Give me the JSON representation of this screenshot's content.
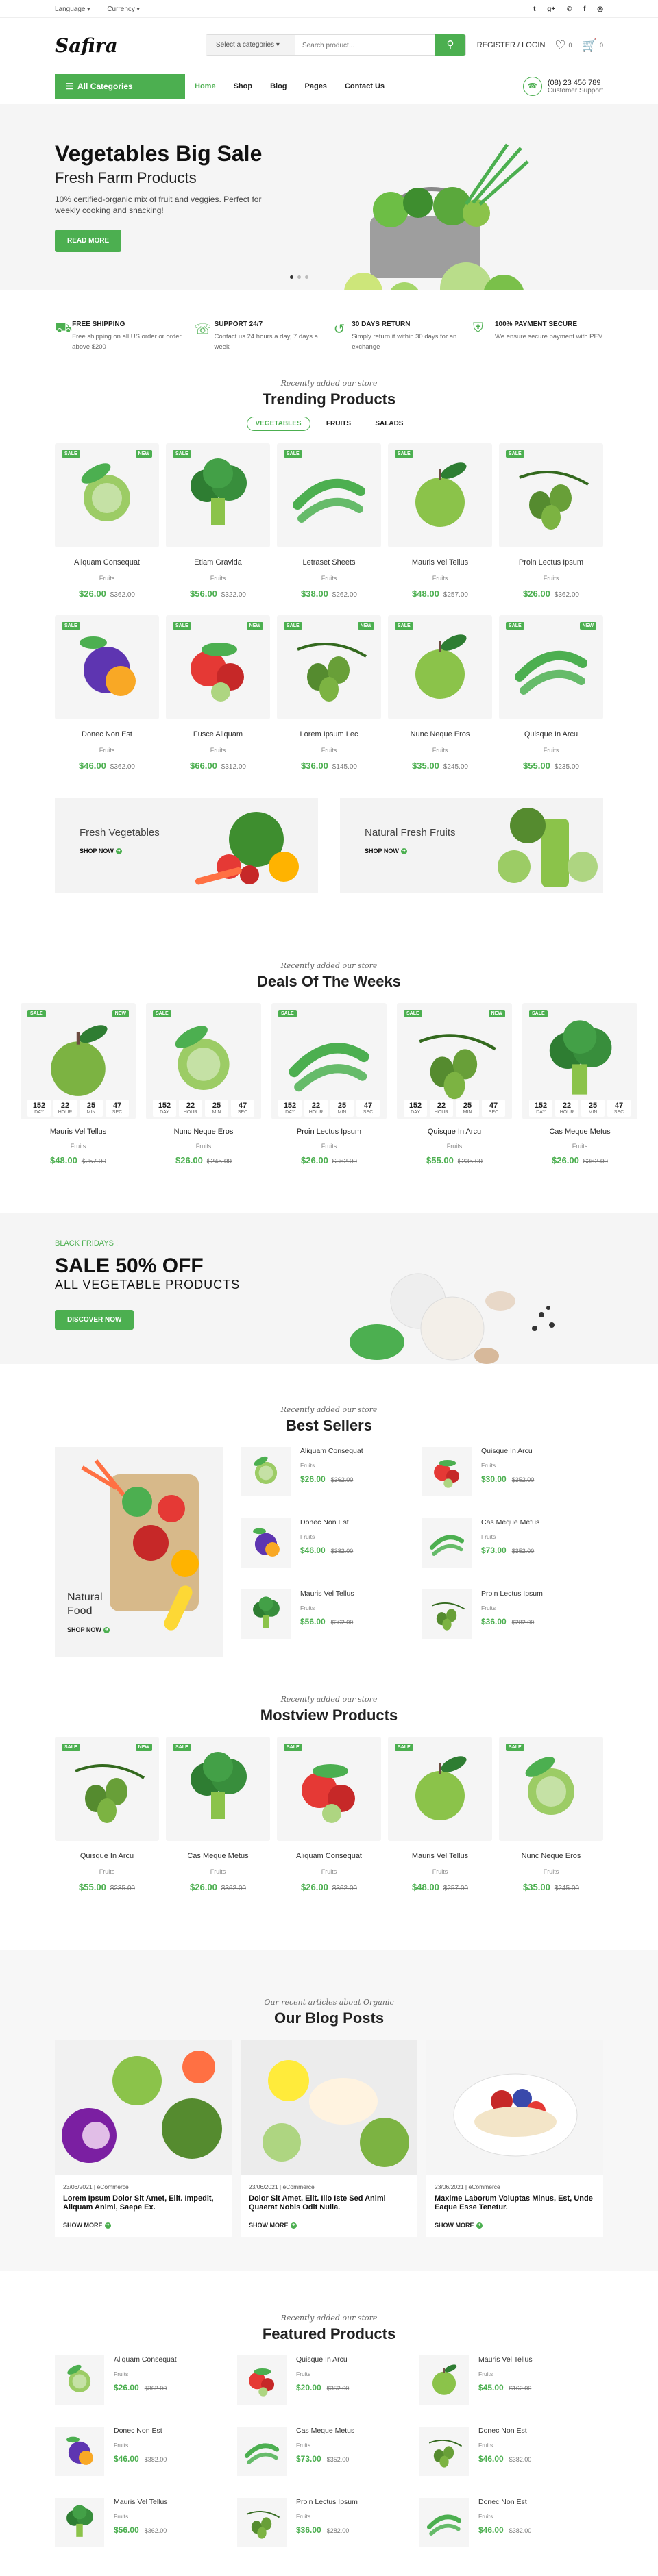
{
  "topbar": {
    "language": "Language",
    "currency": "Currency",
    "social": [
      "t",
      "g+",
      "©",
      "f",
      "◎"
    ]
  },
  "header": {
    "logo": "Safira",
    "category_select": "Select a categories",
    "search_placeholder": "Search product...",
    "register": "REGISTER / LOGIN",
    "wishlist_count": "0",
    "cart_count": "0"
  },
  "nav": {
    "all_categories": "All Categories",
    "links": [
      "Home",
      "Shop",
      "Blog",
      "Pages",
      "Contact Us"
    ],
    "phone": "(08) 23 456 789",
    "support_label": "Customer Support"
  },
  "hero": {
    "title": "Vegetables Big Sale",
    "subtitle": "Fresh Farm Products",
    "text": "10% certified-organic mix of fruit and veggies. Perfect for weekly cooking and snacking!",
    "button": "READ MORE"
  },
  "features": [
    {
      "title": "FREE SHIPPING",
      "text": "Free shipping on all US order or order above $200"
    },
    {
      "title": "SUPPORT 24/7",
      "text": "Contact us 24 hours a day, 7 days a week"
    },
    {
      "title": "30 DAYS RETURN",
      "text": "Simply return it within 30 days for an exchange"
    },
    {
      "title": "100% PAYMENT SECURE",
      "text": "We ensure secure payment with PEV"
    }
  ],
  "trending": {
    "sub": "Recently added our store",
    "title": "Trending Products",
    "tabs": [
      "VEGETABLES",
      "FRUITS",
      "SALADS"
    ],
    "products": [
      {
        "name": "Aliquam Consequat",
        "cat": "Fruits",
        "price": "$26.00",
        "old": "$362.00"
      },
      {
        "name": "Etiam Gravida",
        "cat": "Fruits",
        "price": "$56.00",
        "old": "$322.00"
      },
      {
        "name": "Letraset Sheets",
        "cat": "Fruits",
        "price": "$38.00",
        "old": "$262.00"
      },
      {
        "name": "Mauris Vel Tellus",
        "cat": "Fruits",
        "price": "$48.00",
        "old": "$257.00"
      },
      {
        "name": "Proin Lectus Ipsum",
        "cat": "Fruits",
        "price": "$26.00",
        "old": "$362.00"
      },
      {
        "name": "Donec Non Est",
        "cat": "Fruits",
        "price": "$46.00",
        "old": "$362.00"
      },
      {
        "name": "Fusce Aliquam",
        "cat": "Fruits",
        "price": "$66.00",
        "old": "$312.00"
      },
      {
        "name": "Lorem Ipsum Lec",
        "cat": "Fruits",
        "price": "$36.00",
        "old": "$145.00"
      },
      {
        "name": "Nunc Neque Eros",
        "cat": "Fruits",
        "price": "$35.00",
        "old": "$245.00"
      },
      {
        "name": "Quisque In Arcu",
        "cat": "Fruits",
        "price": "$55.00",
        "old": "$235.00"
      }
    ]
  },
  "banners": [
    {
      "title": "Fresh Vegetables",
      "link": "SHOP NOW"
    },
    {
      "title": "Natural Fresh Fruits",
      "link": "SHOP NOW"
    }
  ],
  "deals": {
    "sub": "Recently added our store",
    "title": "Deals Of The Weeks",
    "countdown": {
      "days": "152",
      "hours": "22",
      "mins": "25",
      "secs": "47",
      "l_day": "DAY",
      "l_hour": "HOUR",
      "l_min": "MIN",
      "l_sec": "SEC"
    },
    "products": [
      {
        "name": "Mauris Vel Tellus",
        "cat": "Fruits",
        "price": "$48.00",
        "old": "$257.00"
      },
      {
        "name": "Nunc Neque Eros",
        "cat": "Fruits",
        "price": "$26.00",
        "old": "$245.00"
      },
      {
        "name": "Proin Lectus Ipsum",
        "cat": "Fruits",
        "price": "$26.00",
        "old": "$362.00"
      },
      {
        "name": "Quisque In Arcu",
        "cat": "Fruits",
        "price": "$55.00",
        "old": "$235.00"
      },
      {
        "name": "Cas Meque Metus",
        "cat": "Fruits",
        "price": "$26.00",
        "old": "$362.00"
      }
    ]
  },
  "promo": {
    "kicker": "BLACK FRIDAYS !",
    "title": "SALE 50% OFF",
    "subtitle": "ALL VEGETABLE PRODUCTS",
    "button": "DISCOVER NOW"
  },
  "best": {
    "sub": "Recently added our store",
    "title": "Best Sellers",
    "banner": "Natural Food",
    "banner_link": "SHOP NOW",
    "products": [
      {
        "name": "Aliquam Consequat",
        "cat": "Fruits",
        "price": "$26.00",
        "old": "$362.00"
      },
      {
        "name": "Quisque In Arcu",
        "cat": "Fruits",
        "price": "$30.00",
        "old": "$352.00"
      },
      {
        "name": "Donec Non Est",
        "cat": "Fruits",
        "price": "$46.00",
        "old": "$382.00"
      },
      {
        "name": "Cas Meque Metus",
        "cat": "Fruits",
        "price": "$73.00",
        "old": "$352.00"
      },
      {
        "name": "Mauris Vel Tellus",
        "cat": "Fruits",
        "price": "$56.00",
        "old": "$362.00"
      },
      {
        "name": "Proin Lectus Ipsum",
        "cat": "Fruits",
        "price": "$36.00",
        "old": "$282.00"
      }
    ]
  },
  "mostview": {
    "sub": "Recently added our store",
    "title": "Mostview Products",
    "products": [
      {
        "name": "Quisque In Arcu",
        "cat": "Fruits",
        "price": "$55.00",
        "old": "$235.00"
      },
      {
        "name": "Cas Meque Metus",
        "cat": "Fruits",
        "price": "$26.00",
        "old": "$362.00"
      },
      {
        "name": "Aliquam Consequat",
        "cat": "Fruits",
        "price": "$26.00",
        "old": "$362.00"
      },
      {
        "name": "Mauris Vel Tellus",
        "cat": "Fruits",
        "price": "$48.00",
        "old": "$257.00"
      },
      {
        "name": "Nunc Neque Eros",
        "cat": "Fruits",
        "price": "$35.00",
        "old": "$245.00"
      }
    ]
  },
  "blog": {
    "sub": "Our recent articles about Organic",
    "title": "Our Blog Posts",
    "posts": [
      {
        "meta": "23/06/2021 | eCommerce",
        "title": "Lorem Ipsum Dolor Sit Amet, Elit. Impedit, Aliquam Animi, Saepe Ex.",
        "link": "SHOW MORE"
      },
      {
        "meta": "23/06/2021 | eCommerce",
        "title": "Dolor Sit Amet, Elit. Illo Iste Sed Animi Quaerat Nobis Odit Nulla.",
        "link": "SHOW MORE"
      },
      {
        "meta": "23/06/2021 | eCommerce",
        "title": "Maxime Laborum Voluptas Minus, Est, Unde Eaque Esse Tenetur.",
        "link": "SHOW MORE"
      }
    ]
  },
  "featured": {
    "sub": "Recently added our store",
    "title": "Featured Products",
    "products": [
      {
        "name": "Aliquam Consequat",
        "cat": "Fruits",
        "price": "$26.00",
        "old": "$362.00"
      },
      {
        "name": "Quisque In Arcu",
        "cat": "Fruits",
        "price": "$20.00",
        "old": "$352.00"
      },
      {
        "name": "Mauris Vel Tellus",
        "cat": "Fruits",
        "price": "$45.00",
        "old": "$162.00"
      },
      {
        "name": "Donec Non Est",
        "cat": "Fruits",
        "price": "$46.00",
        "old": "$382.00"
      },
      {
        "name": "Cas Meque Metus",
        "cat": "Fruits",
        "price": "$73.00",
        "old": "$352.00"
      },
      {
        "name": "Donec Non Est",
        "cat": "Fruits",
        "price": "$46.00",
        "old": "$382.00"
      },
      {
        "name": "Mauris Vel Tellus",
        "cat": "Fruits",
        "price": "$56.00",
        "old": "$362.00"
      },
      {
        "name": "Proin Lectus Ipsum",
        "cat": "Fruits",
        "price": "$36.00",
        "old": "$282.00"
      },
      {
        "name": "Donec Non Est",
        "cat": "Fruits",
        "price": "$46.00",
        "old": "$382.00"
      }
    ]
  },
  "colors": {
    "accent": "#4caf50",
    "bg_light": "#f5f5f5"
  }
}
